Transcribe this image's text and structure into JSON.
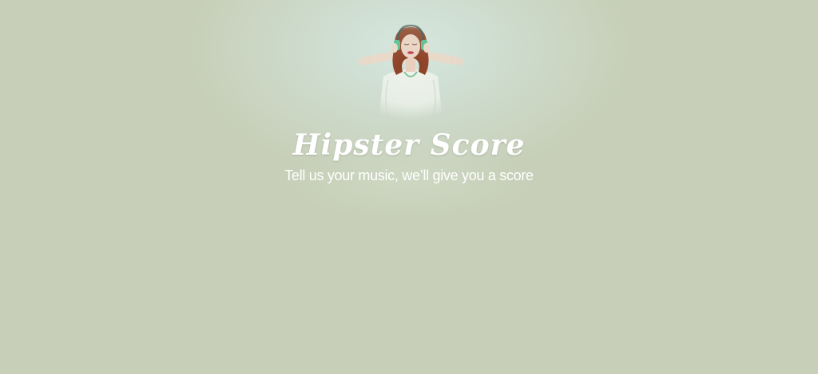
{
  "header": {
    "title": "Hipster Score",
    "tagline": "Tell us your music, we’ll give you a score",
    "hero_image": "woman-with-headphones-photo"
  },
  "colors": {
    "background": "#c7cfb8",
    "glow": "#d6e8e2",
    "text": "#ffffff",
    "headphones": "#4fbf8a",
    "hair": "#8a3a1e"
  }
}
